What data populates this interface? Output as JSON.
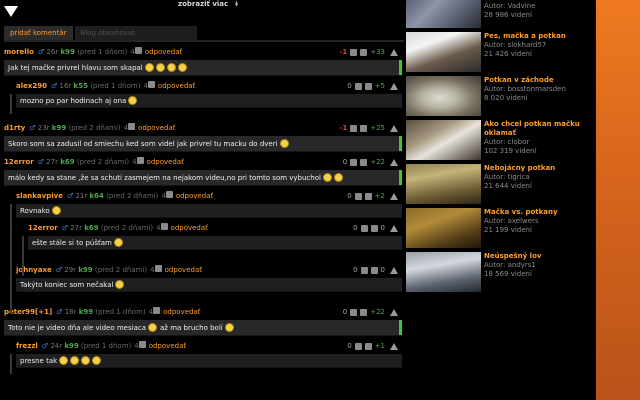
{
  "header": {
    "show_more": "zobraziť viac",
    "show_more_chevron": "↡"
  },
  "tabs": [
    {
      "label": "pridať komentár",
      "active": true
    },
    {
      "label": "Blog obsahovat",
      "active": false
    }
  ],
  "comments": [
    {
      "user": "morello",
      "gender": "♂",
      "age": "26r",
      "points": "k99",
      "time": "(pred 1 dňom)",
      "count": "4",
      "reply": "odpovedať",
      "neg": "-1",
      "pos": "+33",
      "text": "Jak tej mačke privrel hlavu som skapal",
      "smileys": 4
    },
    {
      "user": "alex290",
      "gender": "♂",
      "age": "16r",
      "points": "k55",
      "time": "(pred 1 dňom)",
      "count": "4",
      "reply": "odpovedať",
      "neg": "0",
      "pos": "+5",
      "text": "mozno po par hodinach aj ona",
      "smileys": 1
    },
    {
      "user": "d1rty",
      "gender": "♂",
      "age": "23r",
      "points": "k99",
      "time": "(pred 2 dňami)",
      "count": "4",
      "reply": "odpovedať",
      "neg": "-1",
      "pos": "+25",
      "text": "Skoro som sa zadusil od smiechu ked som videl jak privrel tu macku do dveri",
      "smileys": 1
    },
    {
      "user": "12error",
      "gender": "♂",
      "age": "27r",
      "points": "k69",
      "time": "(pred 2 dňami)",
      "count": "4",
      "reply": "odpovedať",
      "neg": "0",
      "pos": "+22",
      "text": "málo kedy sa stane ,že sa schuti zasmejem na nejakom videu,no pri tomto som vybuchol",
      "smileys": 2
    },
    {
      "user": "slankavpive",
      "gender": "♂",
      "age": "21r",
      "points": "k64",
      "time": "(pred 2 dňami)",
      "count": "4",
      "reply": "odpovedať",
      "neg": "0",
      "pos": "+2",
      "text": "Rovnako",
      "smileys": 1
    },
    {
      "user": "12error",
      "gender": "♂",
      "age": "27r",
      "points": "k69",
      "time": "(pred 2 dňami)",
      "count": "4",
      "reply": "odpovedať",
      "neg": "0",
      "pos": "0",
      "text": "ešte stále si to púšťam",
      "smileys": 1
    },
    {
      "user": "johnyaxe",
      "gender": "♂",
      "age": "29r",
      "points": "k99",
      "time": "(pred 2 dňami)",
      "count": "4",
      "reply": "odpovedať",
      "neg": "0",
      "pos": "0",
      "text": "Takýto koniec som nečakal",
      "smileys": 1
    },
    {
      "user": "peter99[+1]",
      "gender": "♂",
      "age": "18r",
      "points": "k99",
      "time": "(pred 1 dňom)",
      "count": "4",
      "reply": "odpovedať",
      "neg": "0",
      "pos": "+22",
      "text": "Toto nie je video dňa ale video mesiaca",
      "text2": "až ma brucho bolí",
      "smileys": 1
    },
    {
      "user": "frezzl",
      "gender": "♂",
      "age": "24r",
      "points": "k99",
      "time": "(pred 1 dňom)",
      "count": "4",
      "reply": "odpovedať",
      "neg": "0",
      "pos": "+1",
      "text": "presne tak",
      "smileys": 4
    }
  ],
  "sidebar": [
    {
      "title": "",
      "author": "Autor: Vadvine",
      "views": "28 986 videní"
    },
    {
      "title": "Pes, mačka a potkan",
      "author": "Autor: slokhard57",
      "views": "21 426 videní"
    },
    {
      "title": "Potkan v záchode",
      "author": "Autor: bosstonmarsden",
      "views": "8 020 videní"
    },
    {
      "title": "Ako chcel potkan mačku oklamať",
      "author": "Autor: clobor",
      "views": "102 319 videní"
    },
    {
      "title": "Nebojácny potkan",
      "author": "Autor: tigrica",
      "views": "21 644 videní"
    },
    {
      "title": "Mačka vs. potkany",
      "author": "Autor: axelwers",
      "views": "21 199 videní"
    },
    {
      "title": "Neúspešný lov",
      "author": "Autor: andyrs1",
      "views": "18 569 videní"
    }
  ],
  "colors": {
    "accent": "#ff9d2b",
    "positive": "#4da64d",
    "negative": "#d44242",
    "gender": "#4e7fd6"
  }
}
